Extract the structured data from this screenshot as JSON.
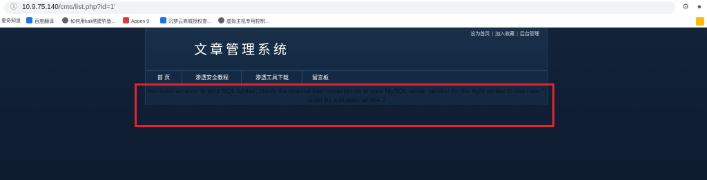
{
  "browser": {
    "url_host": "10.9.75.140",
    "url_path": "/cms/list.php?id=1'",
    "bookmarks": [
      {
        "label": "爱奇知道",
        "color": "#6aa84f"
      },
      {
        "label": "百度翻译",
        "color": "#1a73e8"
      },
      {
        "label": "如何用kali搭建钓鱼...",
        "color": "#5f6368"
      },
      {
        "label": "Appen 9",
        "color": "#e53935"
      },
      {
        "label": "沉梦云商城授权查...",
        "color": "#1a73e8"
      },
      {
        "label": "虚拟主机专用控制...",
        "color": "#5f6368"
      }
    ]
  },
  "site": {
    "logo": "文章管理系统",
    "top_links": [
      "设为首页",
      "加入收藏",
      "后台管理"
    ],
    "nav": [
      "首 页",
      "渗透安全教程",
      "渗透工具下载",
      "留言板"
    ]
  },
  "error": {
    "message": "You have an error in your SQL syntax; check the manual that corresponds to your MySQL server version for the right syntax to use near '') order by a.id desc' at line 7"
  }
}
